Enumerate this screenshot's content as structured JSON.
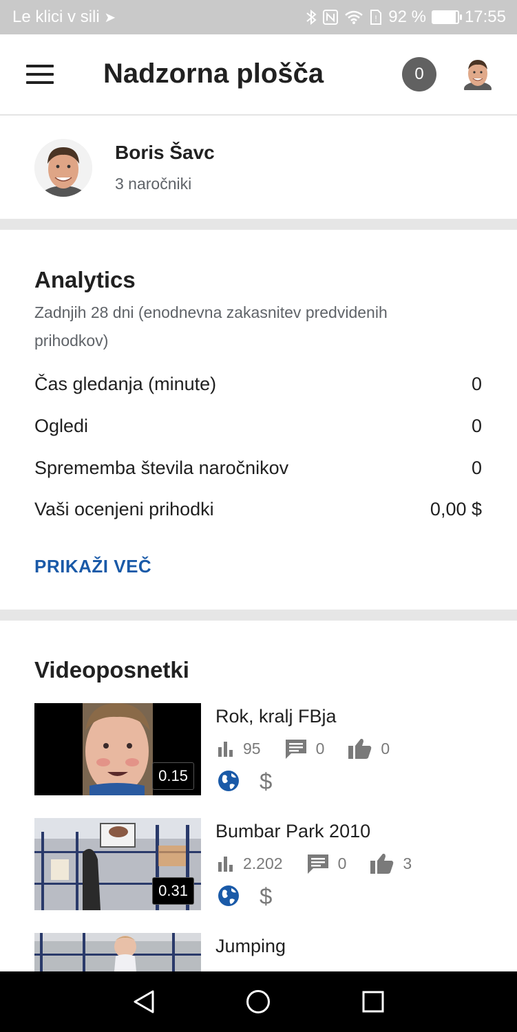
{
  "status_bar": {
    "carrier": "Le klici v sili",
    "battery": "92 %",
    "battery_level": 0.92,
    "time": "17:55",
    "icons": [
      "bluetooth-icon",
      "nfc-icon",
      "wifi-icon",
      "sim-icon",
      "battery-icon"
    ]
  },
  "app_bar": {
    "title": "Nadzorna plošča",
    "notification_count": "0",
    "icons": [
      "menu-icon",
      "avatar"
    ]
  },
  "profile": {
    "name": "Boris Šavc",
    "subscribers": "3 naročniki"
  },
  "analytics": {
    "title": "Analytics",
    "subtitle": "Zadnjih 28 dni (enodnevna zakasnitev predvidenih prihodkov)",
    "metrics": [
      {
        "label": "Čas gledanja (minute)",
        "value": "0"
      },
      {
        "label": "Ogledi",
        "value": "0"
      },
      {
        "label": "Sprememba števila naročnikov",
        "value": "0"
      },
      {
        "label": "Vaši ocenjeni prihodki",
        "value": "0,00 $"
      }
    ],
    "show_more": "PRIKAŽI VEČ"
  },
  "videos": {
    "title": "Videoposnetki",
    "items": [
      {
        "title": "Rok, kralj FBja",
        "duration": "0.15",
        "views": "95",
        "comments": "0",
        "likes": "0",
        "visibility_icon": "globe-icon",
        "monetization": "$"
      },
      {
        "title": "Bumbar Park 2010",
        "duration": "0.31",
        "views": "2.202",
        "comments": "0",
        "likes": "3",
        "visibility_icon": "globe-icon",
        "monetization": "$"
      },
      {
        "title": "Jumping"
      }
    ]
  },
  "colors": {
    "accent": "#1a5aa8",
    "status_bar": "#c9c9c9",
    "badge": "#616161",
    "separator": "#e6e6e6"
  }
}
